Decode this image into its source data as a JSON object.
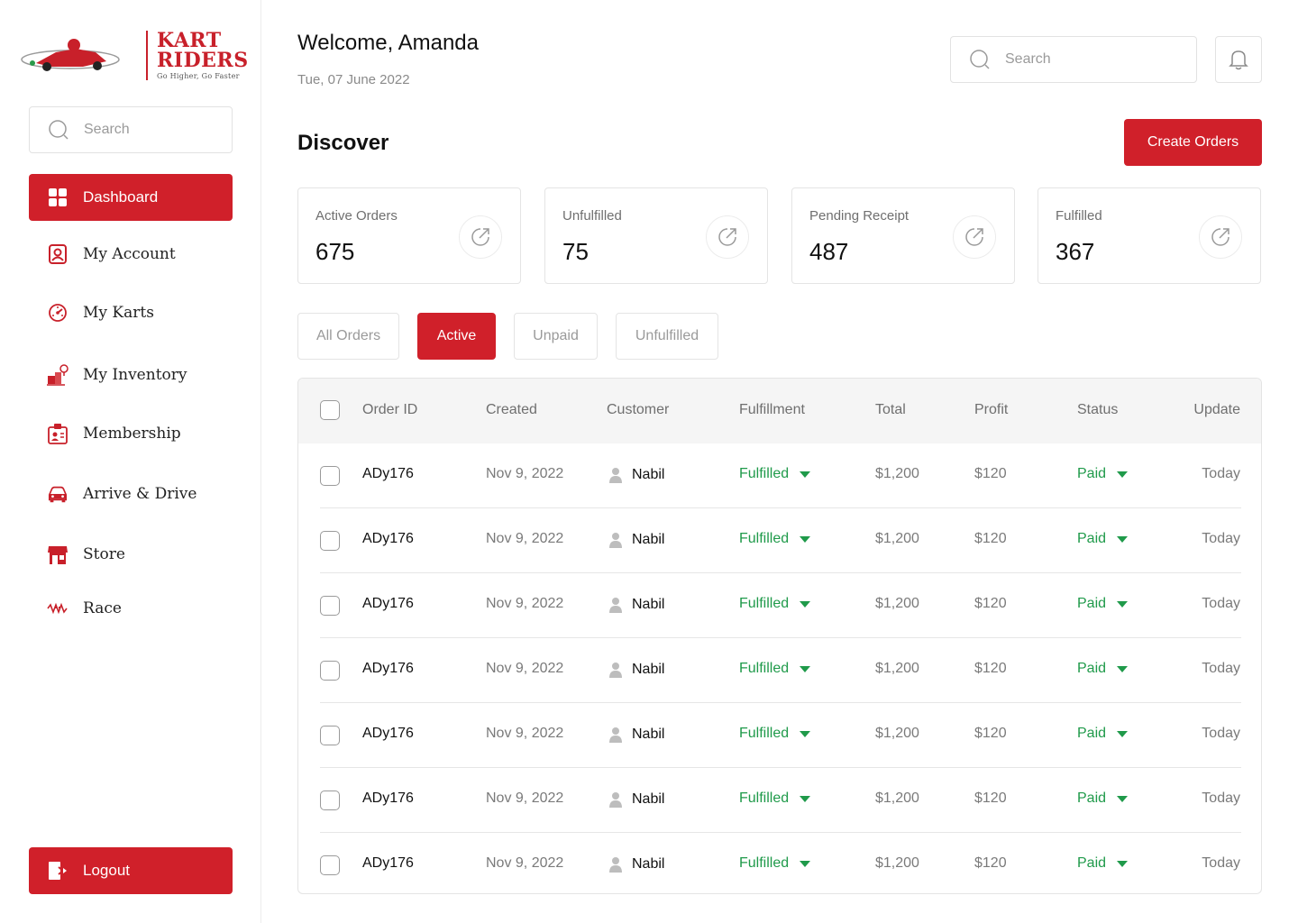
{
  "brand": {
    "line1": "KART",
    "line2": "RIDERS",
    "tagline": "Go Higher, Go Faster",
    "accent": "#d0202a"
  },
  "sidebar": {
    "search_placeholder": "Search",
    "items": [
      {
        "label": "Dashboard",
        "icon": "dashboard-grid-icon",
        "active": true
      },
      {
        "label": "My Account",
        "icon": "account-icon"
      },
      {
        "label": "My Karts",
        "icon": "speedometer-icon"
      },
      {
        "label": "My Inventory",
        "icon": "inventory-icon"
      },
      {
        "label": "Membership",
        "icon": "membership-badge-icon"
      },
      {
        "label": "Arrive & Drive",
        "icon": "car-icon"
      },
      {
        "label": "Store",
        "icon": "store-icon"
      },
      {
        "label": "Race",
        "icon": "race-flag-icon"
      }
    ],
    "logout_label": "Logout"
  },
  "header": {
    "welcome": "Welcome, Amanda",
    "date": "Tue, 07 June 2022",
    "search_placeholder": "Search"
  },
  "discover": {
    "title": "Discover",
    "create_label": "Create Orders",
    "stats": [
      {
        "label": "Active Orders",
        "value": "675"
      },
      {
        "label": "Unfulfilled",
        "value": "75"
      },
      {
        "label": "Pending Receipt",
        "value": "487"
      },
      {
        "label": "Fulfilled",
        "value": "367"
      }
    ]
  },
  "filters": [
    {
      "label": "All Orders"
    },
    {
      "label": "Active",
      "active": true
    },
    {
      "label": "Unpaid"
    },
    {
      "label": "Unfulfilled"
    }
  ],
  "table": {
    "columns": [
      "Order ID",
      "Created",
      "Customer",
      "Fulfillment",
      "Total",
      "Profit",
      "Status",
      "Update"
    ],
    "rows": [
      {
        "order_id": "ADy176",
        "created": "Nov 9, 2022",
        "customer": "Nabil",
        "fulfillment": "Fulfilled",
        "total": "$1,200",
        "profit": "$120",
        "status": "Paid",
        "update": "Today"
      },
      {
        "order_id": "ADy176",
        "created": "Nov 9, 2022",
        "customer": "Nabil",
        "fulfillment": "Fulfilled",
        "total": "$1,200",
        "profit": "$120",
        "status": "Paid",
        "update": "Today"
      },
      {
        "order_id": "ADy176",
        "created": "Nov 9, 2022",
        "customer": "Nabil",
        "fulfillment": "Fulfilled",
        "total": "$1,200",
        "profit": "$120",
        "status": "Paid",
        "update": "Today"
      },
      {
        "order_id": "ADy176",
        "created": "Nov 9, 2022",
        "customer": "Nabil",
        "fulfillment": "Fulfilled",
        "total": "$1,200",
        "profit": "$120",
        "status": "Paid",
        "update": "Today"
      },
      {
        "order_id": "ADy176",
        "created": "Nov 9, 2022",
        "customer": "Nabil",
        "fulfillment": "Fulfilled",
        "total": "$1,200",
        "profit": "$120",
        "status": "Paid",
        "update": "Today"
      },
      {
        "order_id": "ADy176",
        "created": "Nov 9, 2022",
        "customer": "Nabil",
        "fulfillment": "Fulfilled",
        "total": "$1,200",
        "profit": "$120",
        "status": "Paid",
        "update": "Today"
      },
      {
        "order_id": "ADy176",
        "created": "Nov 9, 2022",
        "customer": "Nabil",
        "fulfillment": "Fulfilled",
        "total": "$1,200",
        "profit": "$120",
        "status": "Paid",
        "update": "Today"
      }
    ],
    "status_color": "#1f9a4a"
  }
}
